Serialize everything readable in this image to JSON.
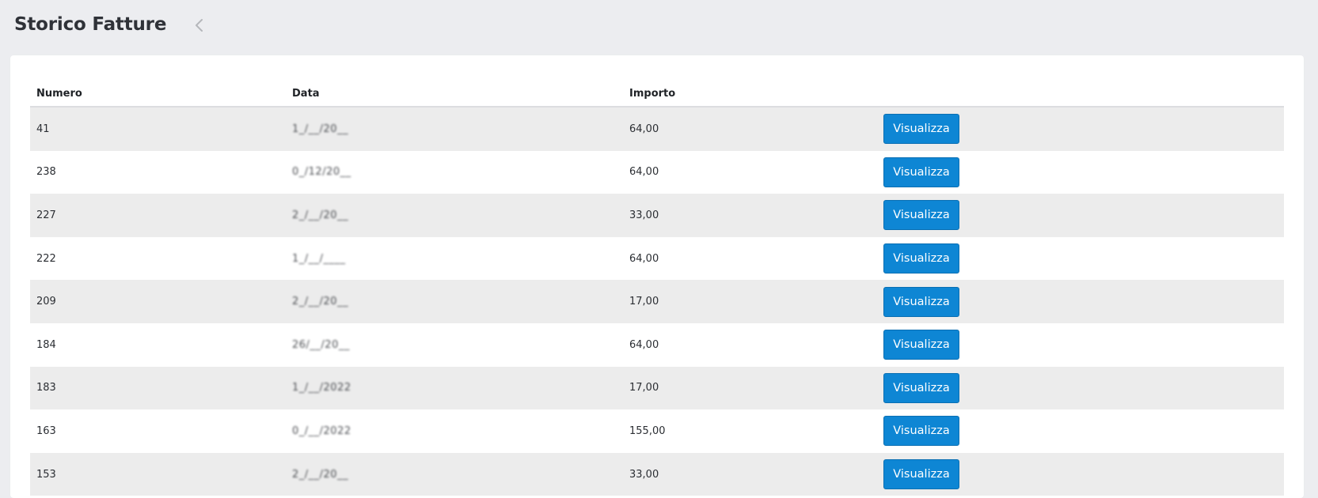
{
  "header": {
    "title": "Storico Fatture",
    "back_icon": "chevron-left-icon"
  },
  "table": {
    "columns": {
      "number": "Numero",
      "date": "Data",
      "amount": "Importo"
    },
    "rows": [
      {
        "number": "41",
        "date": "1_/__/20__",
        "amount": "64,00",
        "action": "Visualizza"
      },
      {
        "number": "238",
        "date": "0_/12/20__",
        "amount": "64,00",
        "action": "Visualizza"
      },
      {
        "number": "227",
        "date": "2_/__/20__",
        "amount": "33,00",
        "action": "Visualizza"
      },
      {
        "number": "222",
        "date": "1_/__/____",
        "amount": "64,00",
        "action": "Visualizza"
      },
      {
        "number": "209",
        "date": "2_/__/20__",
        "amount": "17,00",
        "action": "Visualizza"
      },
      {
        "number": "184",
        "date": "26/__/20__",
        "amount": "64,00",
        "action": "Visualizza"
      },
      {
        "number": "183",
        "date": "1_/__/2022",
        "amount": "17,00",
        "action": "Visualizza"
      },
      {
        "number": "163",
        "date": "0_/__/2022",
        "amount": "155,00",
        "action": "Visualizza"
      },
      {
        "number": "153",
        "date": "2_/__/20__",
        "amount": "33,00",
        "action": "Visualizza"
      }
    ]
  },
  "colors": {
    "page_bg": "#ecedf0",
    "button_bg": "#0e86d4",
    "row_stripe": "#ececec"
  }
}
